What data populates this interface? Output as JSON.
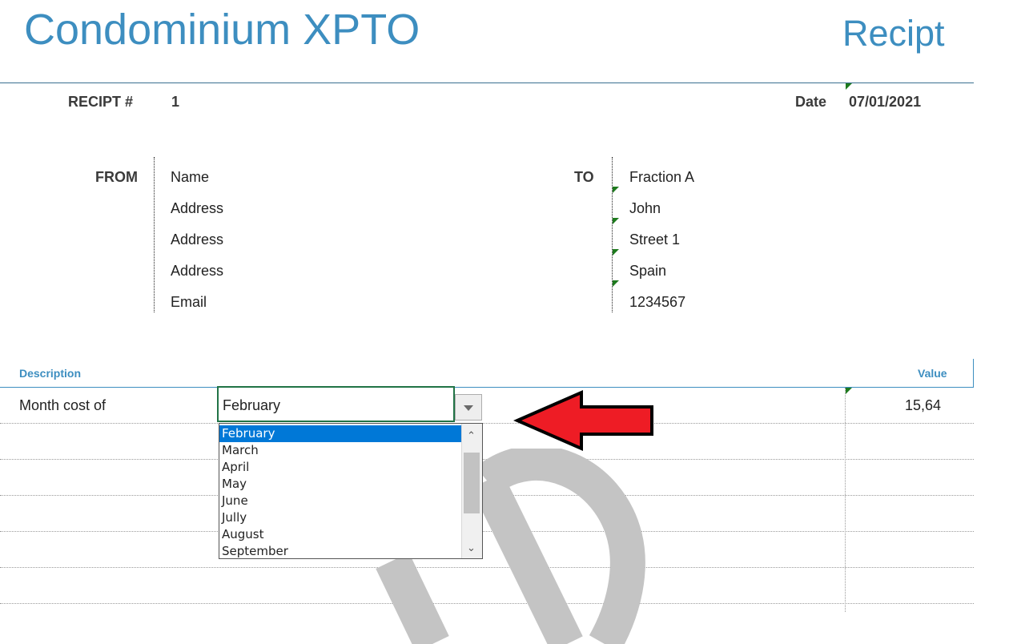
{
  "company_name": "Condominium XPTO",
  "document_title": "Recipt",
  "receipt": {
    "number_label": "RECIPT #",
    "number": "1",
    "date_label": "Date",
    "date": "07/01/2021"
  },
  "from": {
    "label": "FROM",
    "lines": [
      "Name",
      "Address",
      "Address",
      "Address",
      "Email"
    ]
  },
  "to": {
    "label": "TO",
    "lines": [
      "Fraction A",
      "John",
      "Street 1",
      "Spain",
      "1234567"
    ]
  },
  "table": {
    "headers": {
      "description": "Description",
      "value": "Value"
    },
    "row": {
      "description": "Month cost of",
      "month": "February",
      "value": "15,64"
    }
  },
  "month_dropdown": {
    "options": [
      "February",
      "March",
      "April",
      "May",
      "June",
      "Jully",
      "August",
      "September"
    ],
    "selected": "February"
  },
  "colors": {
    "accent": "#3d8ec0",
    "selection": "#0078d7",
    "arrow": "#ee1c25",
    "active_cell_border": "#217346"
  },
  "icons": {
    "dropdown": "chevron-down-icon",
    "scroll_up": "chevron-up-icon",
    "scroll_down": "chevron-down-icon",
    "callout": "arrow-left-icon"
  }
}
